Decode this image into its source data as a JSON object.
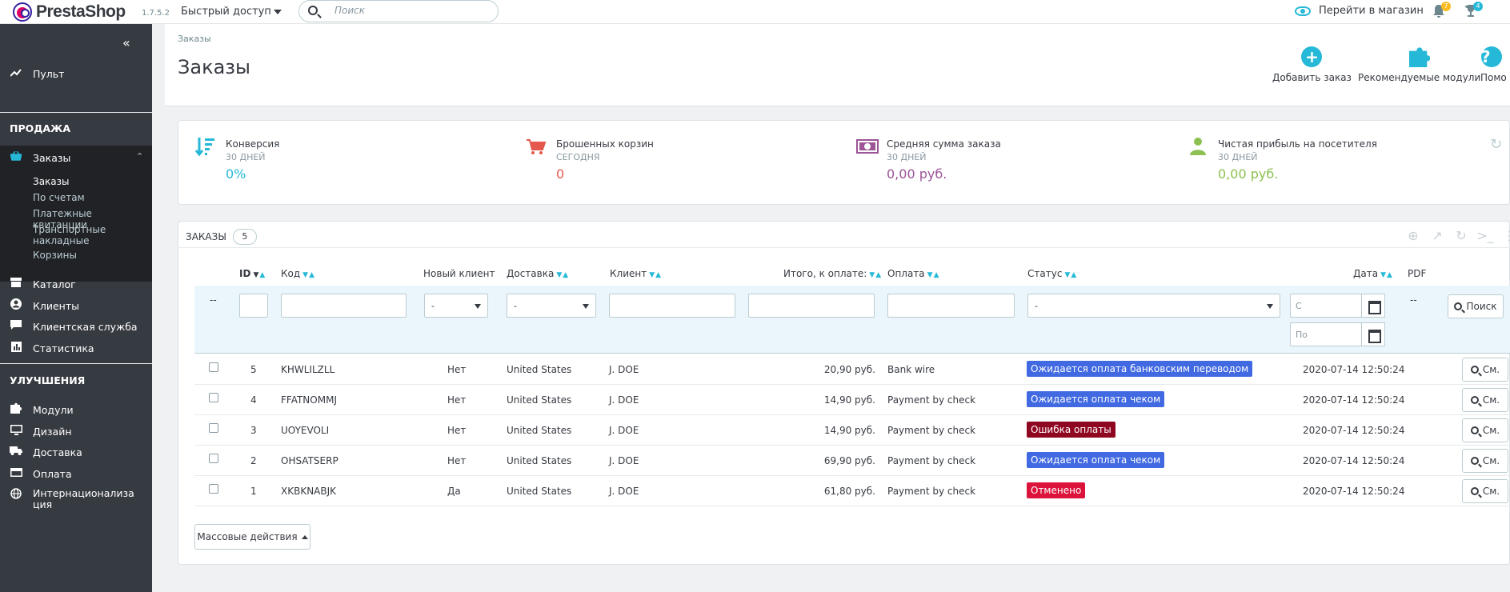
{
  "header": {
    "logo_text": "PrestaShop",
    "version": "1.7.5.2",
    "quick_access": "Быстрый доступ",
    "search_placeholder": "Поиск",
    "shop_link": "Перейти в магазин",
    "bell_count": "7",
    "trophy_count": "4"
  },
  "sidebar": {
    "collapse_icon": "«",
    "dashboard": "Пульт",
    "section_sell": "ПРОДАЖА",
    "orders": "Заказы",
    "sub_items": [
      "Заказы",
      "По счетам",
      "Платежные квитанции",
      "Транспортные накладные",
      "Корзины"
    ],
    "catalog": "Каталог",
    "customers": "Клиенты",
    "customer_service": "Клиентская служба",
    "stats": "Статистика",
    "section_improve": "УЛУЧШЕНИЯ",
    "modules": "Модули",
    "design": "Дизайн",
    "shipping": "Доставка",
    "payment": "Оплата",
    "international": "Интернационализация"
  },
  "page": {
    "breadcrumb": "Заказы",
    "title": "Заказы",
    "toolbar": {
      "add_order": "Добавить заказ",
      "recommended": "Рекомендуемые модули",
      "help": "Помо"
    }
  },
  "kpis": [
    {
      "title": "Конверсия",
      "sub": "30 ДНЕЙ",
      "value": "0%",
      "color": "#25b9d7"
    },
    {
      "title": "Брошенных корзин",
      "sub": "СЕГОДНЯ",
      "value": "0",
      "color": "#e5584e"
    },
    {
      "title": "Средняя сумма заказа",
      "sub": "30 ДНЕЙ",
      "value": "0,00 руб.",
      "color": "#9c5497"
    },
    {
      "title": "Чистая прибыль на посетителя",
      "sub": "30 ДНЕЙ",
      "value": "0,00 руб.",
      "color": "#8cc152"
    }
  ],
  "orders": {
    "panel_title": "ЗАКАЗЫ",
    "count": "5",
    "columns": {
      "id": "ID",
      "code": "Код",
      "new_client": "Новый клиент",
      "delivery": "Доставка",
      "client": "Клиент",
      "total": "Итого, к оплате:",
      "payment": "Оплата",
      "status": "Статус",
      "date": "Дата",
      "pdf": "PDF"
    },
    "filters": {
      "dash": "--",
      "select_value": "-",
      "date_from": "С",
      "date_to": "По",
      "pdf_dash": "--",
      "search_btn": "Поиск"
    },
    "rows": [
      {
        "id": "5",
        "code": "KHWLILZLL",
        "new": "Нет",
        "country": "United States",
        "client": "J. DOE",
        "total": "20,90 руб.",
        "payment": "Bank wire",
        "status": "Ожидается оплата банковским переводом",
        "status_color": "#4169e1",
        "date": "2020-07-14 12:50:24",
        "view": "См."
      },
      {
        "id": "4",
        "code": "FFATNOMMJ",
        "new": "Нет",
        "country": "United States",
        "client": "J. DOE",
        "total": "14,90 руб.",
        "payment": "Payment by check",
        "status": "Ожидается оплата чеком",
        "status_color": "#4169e1",
        "date": "2020-07-14 12:50:24",
        "view": "См."
      },
      {
        "id": "3",
        "code": "UOYEVOLI",
        "new": "Нет",
        "country": "United States",
        "client": "J. DOE",
        "total": "14,90 руб.",
        "payment": "Payment by check",
        "status": "Ошибка оплаты",
        "status_color": "#8f0621",
        "date": "2020-07-14 12:50:24",
        "view": "См."
      },
      {
        "id": "2",
        "code": "OHSATSERP",
        "new": "Нет",
        "country": "United States",
        "client": "J. DOE",
        "total": "69,90 руб.",
        "payment": "Payment by check",
        "status": "Ожидается оплата чеком",
        "status_color": "#4169e1",
        "date": "2020-07-14 12:50:24",
        "view": "См."
      },
      {
        "id": "1",
        "code": "XKBKNABJK",
        "new": "Да",
        "country": "United States",
        "client": "J. DOE",
        "total": "61,80 руб.",
        "payment": "Payment by check",
        "status": "Отменено",
        "status_color": "#dc143c",
        "date": "2020-07-14 12:50:24",
        "view": "См."
      }
    ],
    "bulk_actions": "Массовые действия"
  }
}
